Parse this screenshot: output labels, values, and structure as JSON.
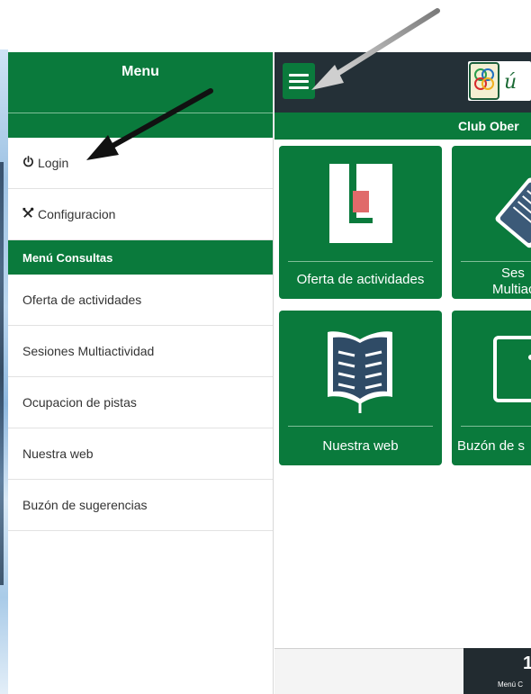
{
  "sidebar": {
    "title": "Menu",
    "items": [
      {
        "label": "Login",
        "icon": "power-icon"
      },
      {
        "label": "Configuracion",
        "icon": "tools-icon"
      }
    ],
    "section_title": "Menú Consultas",
    "section_items": [
      {
        "label": "Oferta de actividades"
      },
      {
        "label": "Sesiones Multiactividad"
      },
      {
        "label": "Ocupacion de pistas"
      },
      {
        "label": "Nuestra web"
      },
      {
        "label": "Buzón de sugerencias"
      }
    ]
  },
  "main": {
    "menu_button_icon": "hamburger-icon",
    "banner": "Club Ober",
    "tiles": [
      {
        "label": "Oferta de actividades",
        "icon": "activities-logo-icon"
      },
      {
        "label": "Ses Multiac",
        "label_line1": "Ses",
        "label_line2": "Multiac",
        "icon": "papers-icon"
      },
      {
        "label": "Nuestra web",
        "icon": "open-book-icon"
      },
      {
        "label": "Buzón de s",
        "icon": "mailbox-icon"
      }
    ],
    "footer": {
      "number": "1",
      "text": "Menú C"
    }
  },
  "colors": {
    "green": "#0a7a3c",
    "dark": "#243037"
  }
}
